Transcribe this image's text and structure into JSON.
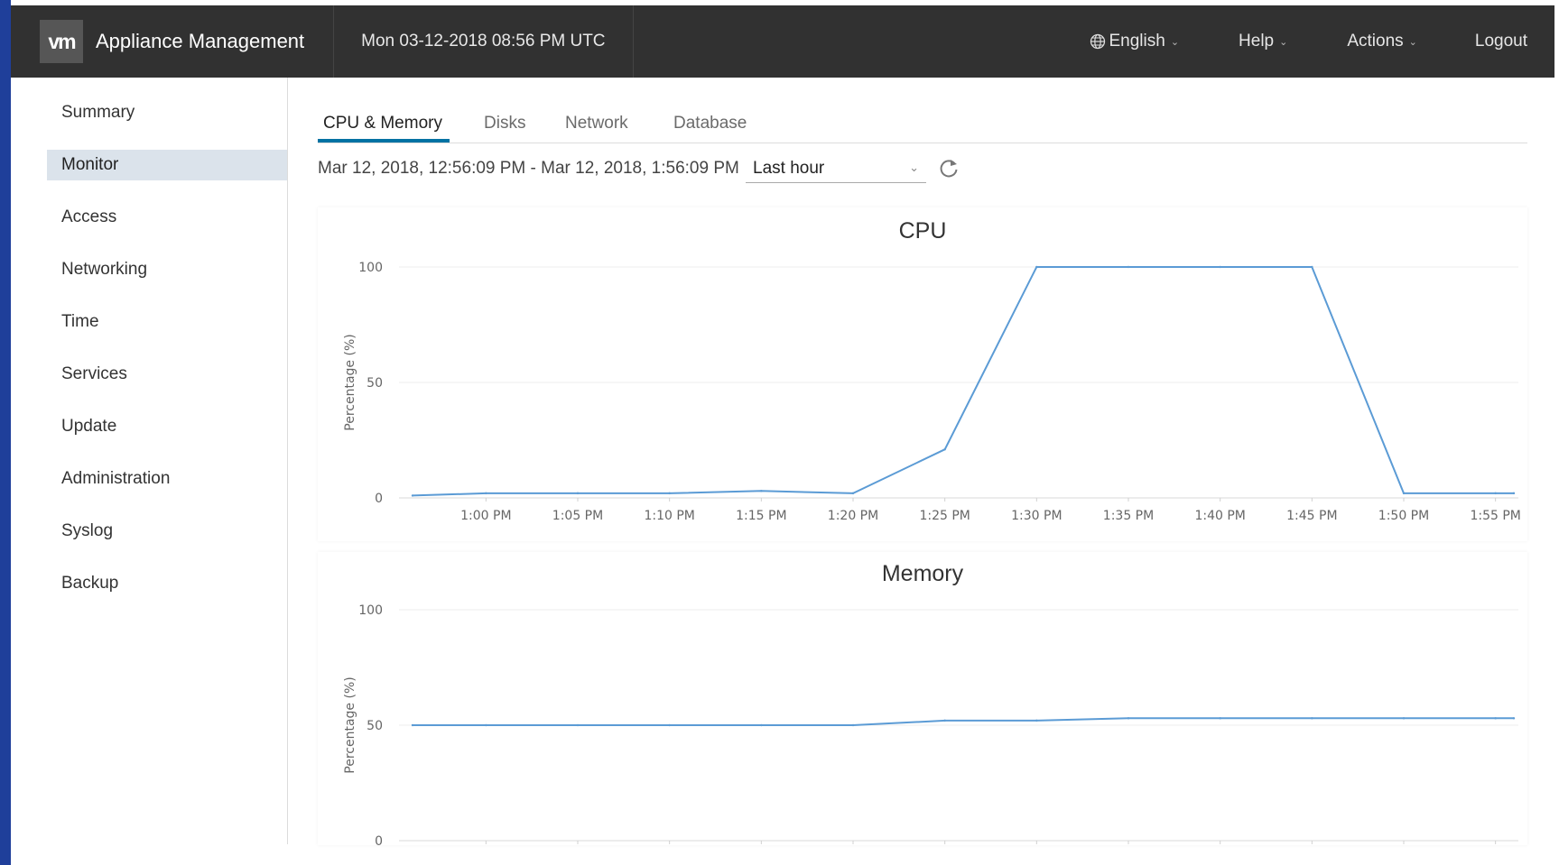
{
  "header": {
    "logo": "vm",
    "title": "Appliance Management",
    "datetime": "Mon 03-12-2018 08:56 PM UTC",
    "menus": {
      "language": "English",
      "help": "Help",
      "actions": "Actions",
      "logout": "Logout"
    }
  },
  "sidebar": {
    "items": [
      {
        "label": "Summary"
      },
      {
        "label": "Monitor",
        "active": true
      },
      {
        "label": "Access"
      },
      {
        "label": "Networking"
      },
      {
        "label": "Time"
      },
      {
        "label": "Services"
      },
      {
        "label": "Update"
      },
      {
        "label": "Administration"
      },
      {
        "label": "Syslog"
      },
      {
        "label": "Backup"
      }
    ]
  },
  "tabs": [
    {
      "label": "CPU & Memory",
      "active": true
    },
    {
      "label": "Disks"
    },
    {
      "label": "Network"
    },
    {
      "label": "Database"
    }
  ],
  "time_range": {
    "text": "Mar 12, 2018, 12:56:09 PM - Mar 12, 2018, 1:56:09 PM",
    "selected": "Last hour"
  },
  "icons": {
    "globe": "globe-icon",
    "refresh": "refresh-icon",
    "caret": "chevron-down-icon"
  },
  "colors": {
    "header_bg": "#313131",
    "line": "#5b9bd5",
    "tab_accent": "#0072a3",
    "active_nav": "#dbe3eb"
  },
  "chart_data": [
    {
      "type": "line",
      "title": "CPU",
      "ylabel": "Percentage (%)",
      "ylim": [
        0,
        100
      ],
      "yticks": [
        0,
        50,
        100
      ],
      "xticks": [
        "1:00 PM",
        "1:05 PM",
        "1:10 PM",
        "1:15 PM",
        "1:20 PM",
        "1:25 PM",
        "1:30 PM",
        "1:35 PM",
        "1:40 PM",
        "1:45 PM",
        "1:50 PM",
        "1:55 PM"
      ],
      "grid": true,
      "series": [
        {
          "x": [
            "12:56 PM",
            "1:00 PM",
            "1:05 PM",
            "1:10 PM",
            "1:15 PM",
            "1:20 PM",
            "1:25 PM",
            "1:30 PM",
            "1:35 PM",
            "1:40 PM",
            "1:45 PM",
            "1:50 PM",
            "1:55 PM",
            "1:56 PM"
          ],
          "values": [
            1,
            2,
            2,
            2,
            3,
            2,
            21,
            100,
            100,
            100,
            100,
            2,
            2,
            2
          ]
        }
      ]
    },
    {
      "type": "line",
      "title": "Memory",
      "ylabel": "Percentage (%)",
      "ylim": [
        0,
        100
      ],
      "yticks": [
        0,
        50,
        100
      ],
      "grid": true,
      "series": [
        {
          "x": [
            "12:56 PM",
            "1:00 PM",
            "1:05 PM",
            "1:10 PM",
            "1:15 PM",
            "1:20 PM",
            "1:25 PM",
            "1:30 PM",
            "1:35 PM",
            "1:40 PM",
            "1:45 PM",
            "1:50 PM",
            "1:55 PM",
            "1:56 PM"
          ],
          "values": [
            50,
            50,
            50,
            50,
            50,
            50,
            52,
            52,
            53,
            53,
            53,
            53,
            53,
            53
          ]
        }
      ]
    }
  ]
}
